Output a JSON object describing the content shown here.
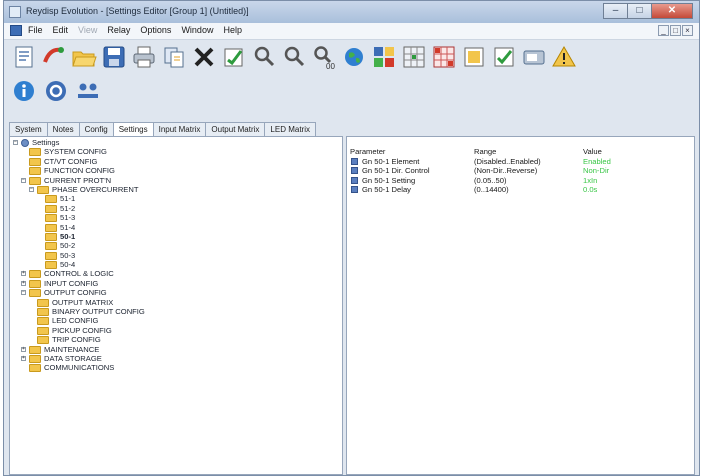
{
  "window": {
    "title": "Reydisp Evolution - [Settings Editor [Group 1] (Untitled)]"
  },
  "window_controls": {
    "minimize": "–",
    "maximize": "□",
    "close": "✕"
  },
  "menu": [
    "File",
    "Edit",
    "View",
    "Relay",
    "Options",
    "Window",
    "Help"
  ],
  "mdi_controls": [
    "_",
    "□",
    "×"
  ],
  "toolbar_row1": [
    {
      "name": "settings-doc-icon"
    },
    {
      "name": "connect-icon"
    },
    {
      "name": "open-folder-icon"
    },
    {
      "name": "save-icon"
    },
    {
      "name": "print-icon"
    },
    {
      "name": "copy-icon"
    },
    {
      "name": "delete-icon"
    },
    {
      "name": "compare-icon"
    },
    {
      "name": "find-icon"
    },
    {
      "name": "find-next-icon"
    },
    {
      "name": "find-group-icon"
    },
    {
      "name": "globe-icon"
    },
    {
      "name": "grid-icon"
    },
    {
      "name": "matrix-icon"
    },
    {
      "name": "matrix-red-icon"
    },
    {
      "name": "export-icon"
    },
    {
      "name": "check-icon"
    },
    {
      "name": "label-icon"
    },
    {
      "name": "warning-icon"
    }
  ],
  "toolbar_row2": [
    {
      "name": "info-icon"
    },
    {
      "name": "refresh-icon"
    },
    {
      "name": "users-icon"
    }
  ],
  "colors": {
    "accent": "#3d6db5",
    "value_green": "#39c646",
    "folder": "#f2c54b"
  },
  "tabs": [
    "System",
    "Notes",
    "Config",
    "Settings",
    "Input Matrix",
    "Output Matrix",
    "LED Matrix"
  ],
  "active_tab": "Settings",
  "tree": [
    {
      "label": "Settings",
      "type": "root"
    },
    {
      "label": "SYSTEM CONFIG"
    },
    {
      "label": "CT/VT CONFIG"
    },
    {
      "label": "FUNCTION CONFIG"
    },
    {
      "label": "CURRENT PROT'N"
    },
    {
      "label": "PHASE OVERCURRENT"
    },
    {
      "label": "51-1"
    },
    {
      "label": "51-2"
    },
    {
      "label": "51-3"
    },
    {
      "label": "51-4"
    },
    {
      "label": "50-1"
    },
    {
      "label": "50-2"
    },
    {
      "label": "50-3"
    },
    {
      "label": "50-4"
    },
    {
      "label": "CONTROL & LOGIC"
    },
    {
      "label": "INPUT CONFIG"
    },
    {
      "label": "OUTPUT CONFIG"
    },
    {
      "label": "OUTPUT MATRIX"
    },
    {
      "label": "BINARY OUTPUT CONFIG"
    },
    {
      "label": "LED CONFIG"
    },
    {
      "label": "PICKUP CONFIG"
    },
    {
      "label": "TRIP CONFIG"
    },
    {
      "label": "MAINTENANCE"
    },
    {
      "label": "DATA STORAGE"
    },
    {
      "label": "COMMUNICATIONS"
    }
  ],
  "param_table": {
    "headers": [
      "Parameter",
      "Range",
      "Value"
    ],
    "rows": [
      {
        "parameter": "Gn 50-1 Element",
        "range": "(Disabled..Enabled)",
        "value": "Enabled"
      },
      {
        "parameter": "Gn 50-1 Dir. Control",
        "range": "(Non-Dir..Reverse)",
        "value": "Non-Dir"
      },
      {
        "parameter": "Gn 50-1 Setting",
        "range": "(0.05..50)",
        "value": "1xIn"
      },
      {
        "parameter": "Gn 50-1 Delay",
        "range": "(0..14400)",
        "value": "0.0s"
      }
    ]
  }
}
